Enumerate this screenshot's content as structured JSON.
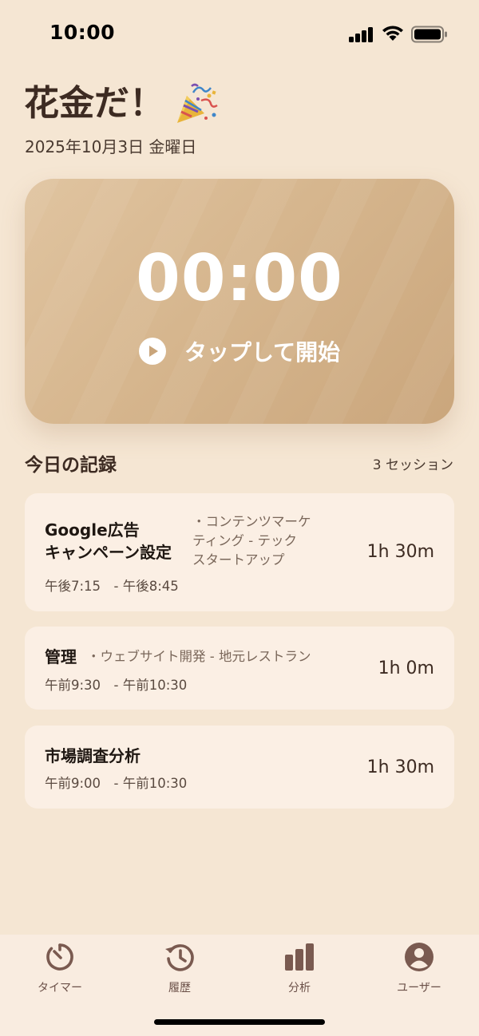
{
  "status_bar": {
    "time": "10:00"
  },
  "header": {
    "greeting": "花金だ！",
    "date": "2025年10月3日 金曜日"
  },
  "timer": {
    "display": "00:00",
    "start_label": "タップして開始"
  },
  "today": {
    "title": "今日の記録",
    "count": "3 セッション",
    "records": [
      {
        "title_line1": "Google広告",
        "title_line2": "キャンペーン設定",
        "project_line1": "・コンテンツマーケ",
        "project_line2": "ティング - テック",
        "project_line3": "スタートアップ",
        "time": "午後7:15　- 午後8:45",
        "duration": "1h 30m"
      },
      {
        "title": "管理",
        "project": "・ウェブサイト開発 - 地元レストラン",
        "time": "午前9:30　- 午前10:30",
        "duration": "1h 0m"
      },
      {
        "title": "市場調査分析",
        "time": "午前9:00　- 午前10:30",
        "duration": "1h 30m"
      }
    ]
  },
  "tab_bar": {
    "accent": "#7a5a50",
    "tabs": [
      {
        "label": "タイマー",
        "icon": "timer-icon"
      },
      {
        "label": "履歴",
        "icon": "history-icon"
      },
      {
        "label": "分析",
        "icon": "bar-chart-icon"
      },
      {
        "label": "ユーザー",
        "icon": "user-icon"
      }
    ]
  }
}
